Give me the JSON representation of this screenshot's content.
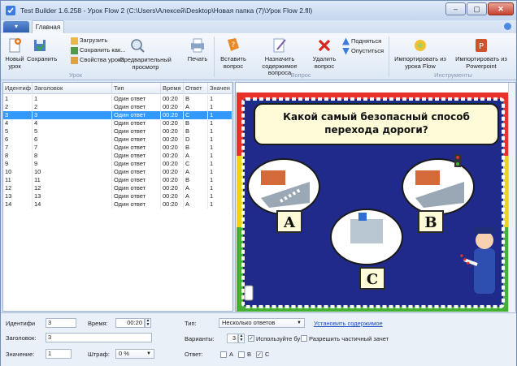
{
  "window": {
    "title": "Test Builder 1.6.258 - Урок Flow 2 (C:\\Users\\Алексей\\Desktop\\Новая папка (7)\\Урок Flow 2.fll)"
  },
  "tabs": {
    "app_menu": "▾",
    "home": "Главная"
  },
  "ribbon": {
    "new_lesson": "Новый урок",
    "save": "Сохранить",
    "load": "Загрузить",
    "save_as": "Сохранить как...",
    "lesson_props": "Свойства урока",
    "preview": "Предварительный просмотр",
    "print": "Печать",
    "group_lesson": "Урок",
    "insert_question": "Вставить вопрос",
    "assign_content": "Назначить содержимое вопроса",
    "delete_question": "Удалить вопрос",
    "move_up": "Подняться",
    "move_down": "Опуститься",
    "group_question": "Вопрос",
    "import_flow": "Импортировать из урока Flow",
    "import_ppt": "Импортировать из Powerpoint",
    "group_tools": "Инструменты"
  },
  "table": {
    "columns": [
      "Идентиф",
      "Заголовок",
      "Тип",
      "Время",
      "Ответ",
      "Значен"
    ],
    "rows": [
      [
        "1",
        "1",
        "Один ответ",
        "00:20",
        "B",
        "1"
      ],
      [
        "2",
        "2",
        "Один ответ",
        "00:20",
        "A",
        "1"
      ],
      [
        "3",
        "3",
        "Один ответ",
        "00:20",
        "C",
        "1"
      ],
      [
        "4",
        "4",
        "Один ответ",
        "00:20",
        "B",
        "1"
      ],
      [
        "5",
        "5",
        "Один ответ",
        "00:20",
        "B",
        "1"
      ],
      [
        "6",
        "6",
        "Один ответ",
        "00:20",
        "D",
        "1"
      ],
      [
        "7",
        "7",
        "Один ответ",
        "00:20",
        "B",
        "1"
      ],
      [
        "8",
        "8",
        "Один ответ",
        "00:20",
        "A",
        "1"
      ],
      [
        "9",
        "9",
        "Один ответ",
        "00:20",
        "C",
        "1"
      ],
      [
        "10",
        "10",
        "Один ответ",
        "00:20",
        "A",
        "1"
      ],
      [
        "11",
        "11",
        "Один ответ",
        "00:20",
        "B",
        "1"
      ],
      [
        "12",
        "12",
        "Один ответ",
        "00:20",
        "A",
        "1"
      ],
      [
        "13",
        "13",
        "Один ответ",
        "00:20",
        "A",
        "1"
      ],
      [
        "14",
        "14",
        "Один ответ",
        "00:20",
        "A",
        "1"
      ]
    ],
    "selected_index": 2
  },
  "slide": {
    "question": "Какой самый безопасный способ перехода дороги?",
    "options": [
      "A",
      "B",
      "C"
    ],
    "colors": {
      "red": "#e63229",
      "yellow": "#f2d31b",
      "green": "#45b035",
      "board": "#1f2a8a"
    }
  },
  "props": {
    "id_label": "Идентифи",
    "id_value": "3",
    "time_label": "Время:",
    "time_value": "00:20",
    "title_label": "Заголовок:",
    "title_value": "3",
    "value_label": "Значение:",
    "value_value": "1",
    "penalty_label": "Штраф:",
    "penalty_value": "0 %",
    "type_label": "Тип:",
    "type_value": "Несколько ответов",
    "set_content": "Установить содержимое",
    "variants_label": "Варианты:",
    "variants_value": "3",
    "use_letters": "Используйте бу",
    "partial_credit": "Разрешить частичный зачет",
    "answer_label": "Ответ:",
    "answers": [
      {
        "label": "A",
        "checked": false
      },
      {
        "label": "B",
        "checked": false
      },
      {
        "label": "C",
        "checked": true
      }
    ]
  }
}
